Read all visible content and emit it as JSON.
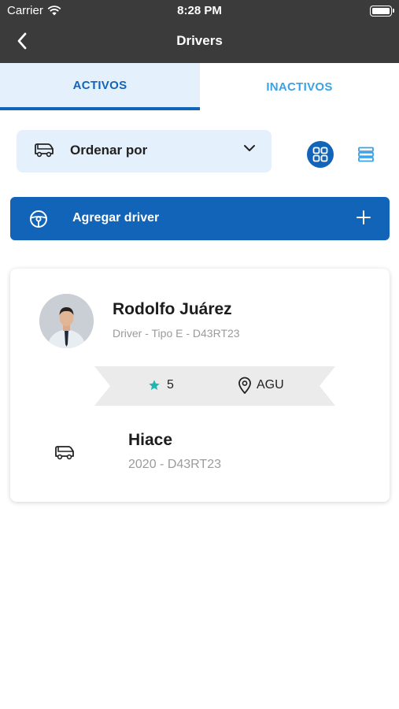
{
  "status_bar": {
    "carrier": "Carrier",
    "time": "8:28 PM"
  },
  "navbar": {
    "title": "Drivers"
  },
  "tabs": [
    {
      "label": "ACTIVOS",
      "active": true
    },
    {
      "label": "INACTIVOS",
      "active": false
    }
  ],
  "sort": {
    "label": "Ordenar por",
    "icon": "van-icon"
  },
  "view_toggle": {
    "grid_icon": "grid-view-icon",
    "list_icon": "list-view-icon",
    "selected": "grid"
  },
  "add_driver": {
    "label": "Agregar driver",
    "icon": "steering-wheel-icon"
  },
  "driver_card": {
    "name": "Rodolfo Juárez",
    "subtitle": "Driver - Tipo E - D43RT23",
    "rating": "5",
    "location": "AGU",
    "vehicle": {
      "name": "Hiace",
      "subtitle": "2020 - D43RT23"
    }
  },
  "colors": {
    "primary": "#1264b8",
    "tab_active_bg": "#e4f0fb",
    "tab_inactive_text": "#3aa2e6",
    "star": "#1fb5b0",
    "topbar": "#3b3b3b"
  }
}
